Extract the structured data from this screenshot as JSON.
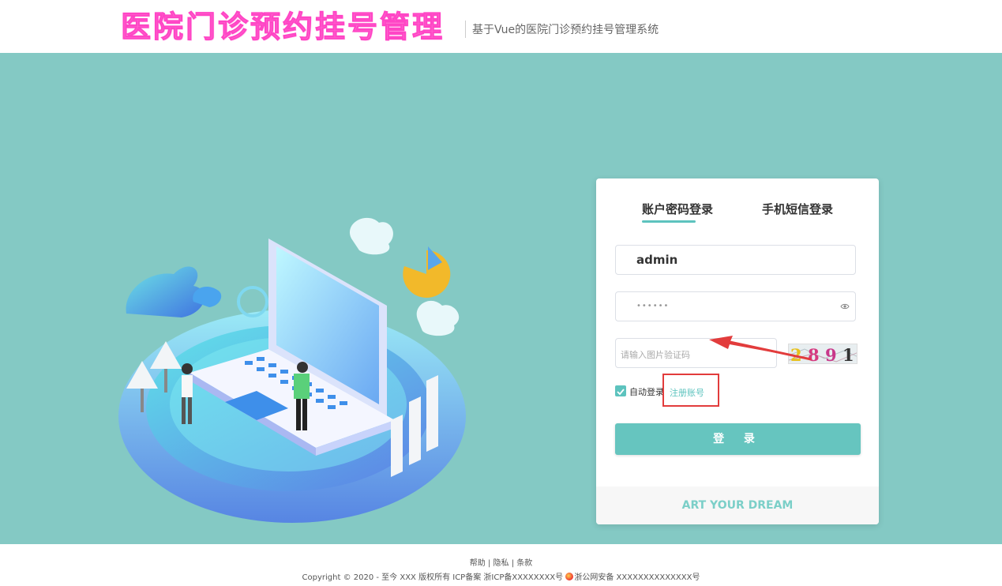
{
  "header": {
    "brand": "医院门诊预约挂号管理",
    "subtitle": "基于Vue的医院门诊预约挂号管理系统"
  },
  "login": {
    "tabs": [
      "账户密码登录",
      "手机短信登录"
    ],
    "active_tab": 0,
    "username_value": "admin",
    "password_mask": "••••••",
    "captcha_placeholder": "请输入图片验证码",
    "captcha_chars": [
      "2",
      "8",
      "9",
      "1"
    ],
    "auto_login_label": "自动登录",
    "auto_login_checked": true,
    "register_link": "注册账号",
    "submit_label": "登 录",
    "slogan": "ART YOUR DREAM"
  },
  "footer": {
    "links": [
      "帮助",
      "隐私",
      "条款"
    ],
    "separator": "|",
    "copyright": "Copyright © 2020 - 至今 XXX 版权所有 ICP备案 浙ICP备XXXXXXXX号",
    "police": "浙公网安备 XXXXXXXXXXXXXX号"
  },
  "colors": {
    "accent": "#5dc3be",
    "background": "#84c9c4",
    "brand": "#ff6fd0",
    "annotation": "#e23c3c"
  },
  "icons": {
    "password_toggle": "eye-icon",
    "checkbox": "check-icon"
  }
}
